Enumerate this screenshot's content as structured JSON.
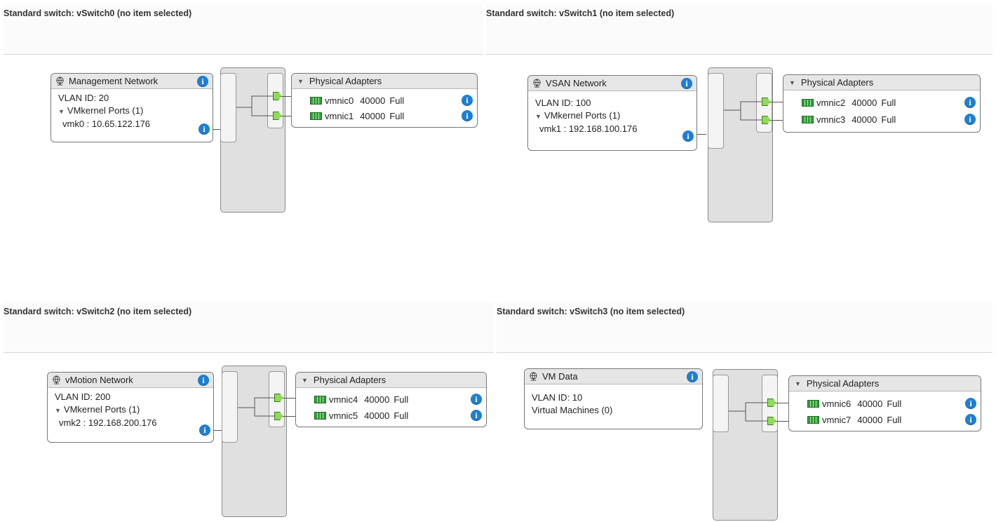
{
  "switches": [
    {
      "header": "Standard switch: vSwitch0 (no item selected)",
      "portgroup": {
        "name": "Management Network",
        "vlan": "VLAN ID: 20",
        "ports_label": "VMkernel Ports (1)",
        "vmk": "vmk0 : 10.65.122.176"
      },
      "adapters_title": "Physical Adapters",
      "adapters": [
        {
          "name": "vmnic0",
          "speed": "40000",
          "duplex": "Full"
        },
        {
          "name": "vmnic1",
          "speed": "40000",
          "duplex": "Full"
        }
      ]
    },
    {
      "header": "Standard switch: vSwitch1 (no item selected)",
      "portgroup": {
        "name": "VSAN Network",
        "vlan": "VLAN ID: 100",
        "ports_label": "VMkernel Ports (1)",
        "vmk": "vmk1 : 192.168.100.176"
      },
      "adapters_title": "Physical Adapters",
      "adapters": [
        {
          "name": "vmnic2",
          "speed": "40000",
          "duplex": "Full"
        },
        {
          "name": "vmnic3",
          "speed": "40000",
          "duplex": "Full"
        }
      ]
    },
    {
      "header": "Standard switch: vSwitch2 (no item selected)",
      "portgroup": {
        "name": "vMotion Network",
        "vlan": "VLAN ID: 200",
        "ports_label": "VMkernel Ports (1)",
        "vmk": "vmk2 : 192.168.200.176"
      },
      "adapters_title": "Physical Adapters",
      "adapters": [
        {
          "name": "vmnic4",
          "speed": "40000",
          "duplex": "Full"
        },
        {
          "name": "vmnic5",
          "speed": "40000",
          "duplex": "Full"
        }
      ]
    },
    {
      "header": "Standard switch: vSwitch3 (no item selected)",
      "portgroup": {
        "name": "VM Data",
        "vlan": "VLAN ID: 10",
        "vms_label": "Virtual Machines (0)"
      },
      "adapters_title": "Physical Adapters",
      "adapters": [
        {
          "name": "vmnic6",
          "speed": "40000",
          "duplex": "Full"
        },
        {
          "name": "vmnic7",
          "speed": "40000",
          "duplex": "Full"
        }
      ]
    }
  ],
  "icons": {
    "portgroup": "network-globe-icon",
    "info": "info-icon",
    "adapter": "nic-icon",
    "port": "port-connector-icon",
    "collapse": "triangle-down-icon"
  },
  "colors": {
    "info": "#1e7fd3",
    "port": "#8fdc58",
    "nic": "#2f9c3a"
  }
}
